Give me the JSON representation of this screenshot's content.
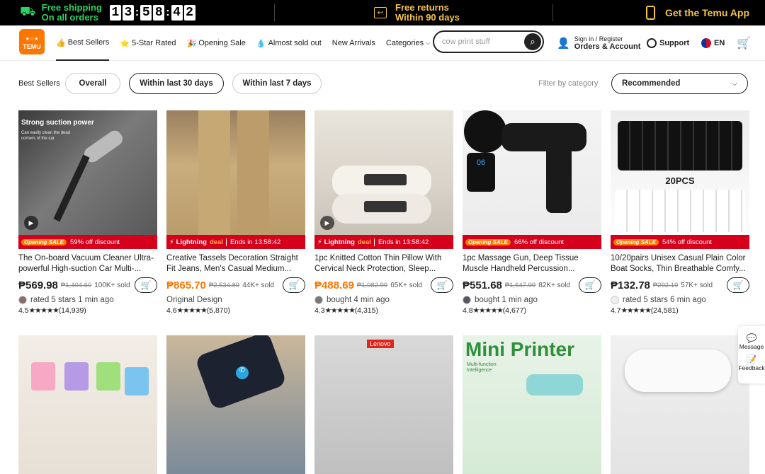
{
  "topbar": {
    "shipping_line1": "Free shipping",
    "shipping_line2": "On all orders",
    "timer": [
      "1",
      "3",
      "5",
      "8",
      "4",
      "2"
    ],
    "returns_line1": "Free returns",
    "returns_line2": "Within 90 days",
    "app_label": "Get the Temu App"
  },
  "header": {
    "logo_text": "TEMU",
    "nav": [
      "Best Sellers",
      "5-Star Rated",
      "Opening Sale",
      "Almost sold out",
      "New Arrivals",
      "Categories"
    ],
    "search_placeholder": "cow print stuff",
    "signin_line1": "Sign in / Register",
    "signin_line2": "Orders & Account",
    "support": "Support",
    "lang": "EN"
  },
  "filters": {
    "label": "Best Sellers",
    "pills": [
      "Overall",
      "Within last 30 days",
      "Within last 7 days"
    ],
    "active": "Within last 30 days",
    "filter_by": "Filter by category",
    "sort": "Recommended"
  },
  "products": [
    {
      "title": "The On-board Vacuum Cleaner Ultra-powerful High-suction Car Multi-...",
      "price": "₱569.98",
      "orig": "₱1,404.60",
      "sold": "100K+ sold",
      "activity": "rated 5 stars 1 min ago",
      "rating": "4.5",
      "stars": "★★★★★",
      "reviews": "(14,939)",
      "badge_type": "opening",
      "badge": "59% off discount",
      "img_caption": "Strong suction power",
      "img_sub": "Can easily clean the dead corners of the car",
      "orange": false
    },
    {
      "title": "Creative Tassels Decoration Straight Fit Jeans, Men's Casual Medium...",
      "price": "₱865.70",
      "orig": "₱2,534.89",
      "sold": "44K+ sold",
      "activity": "Original Design",
      "rating": "4.6",
      "stars": "★★★★★",
      "reviews": "(5,870)",
      "badge_type": "lightning",
      "badge": "Lightning deal",
      "ends": "Ends in 13:58:42",
      "orange": true
    },
    {
      "title": "1pc Knitted Cotton Thin Pillow With Cervical Neck Protection, Sleep...",
      "price": "₱488.69",
      "orig": "₱1,082.99",
      "sold": "65K+ sold",
      "activity": "bought 4 min ago",
      "rating": "4.3",
      "stars": "★★★★★",
      "reviews": "(4,315)",
      "badge_type": "lightning",
      "badge": "Lightning deal",
      "ends": "Ends in 13:58:42",
      "orange": true
    },
    {
      "title": "1pc Massage Gun, Deep Tissue Muscle Handheld Percussion...",
      "price": "₱551.68",
      "orig": "₱1,647.99",
      "sold": "82K+ sold",
      "activity": "bought 1 min ago",
      "rating": "4.8",
      "stars": "★★★★★",
      "reviews": "(4,677)",
      "badge_type": "opening",
      "badge": "66% off discount",
      "orange": false,
      "img_caption": "06"
    },
    {
      "title": "10/20pairs Unisex Casual Plain Color Boat Socks, Thin Breathable Comfy...",
      "price": "₱132.78",
      "orig": "₱292.19",
      "sold": "57K+ sold",
      "activity": "rated 5 stars 6 min ago",
      "rating": "4.7",
      "stars": "★★★★★",
      "reviews": "(24,581)",
      "badge_type": "opening",
      "badge": "54% off discount",
      "orange": false,
      "img_caption": "20PCS"
    }
  ],
  "row2": {
    "lenovo": "Lenovo",
    "printer": "Mini Printer",
    "printer_sub": "Multi-function Intelligence"
  },
  "badge_labels": {
    "opening": "Opening SALE",
    "lightning": "Lightning",
    "deal": "deal"
  },
  "side": {
    "message": "Message",
    "feedback": "Feedback"
  },
  "colors": {
    "accent": "#fb7701",
    "green": "#2bd45e",
    "red": "#d6001c"
  }
}
